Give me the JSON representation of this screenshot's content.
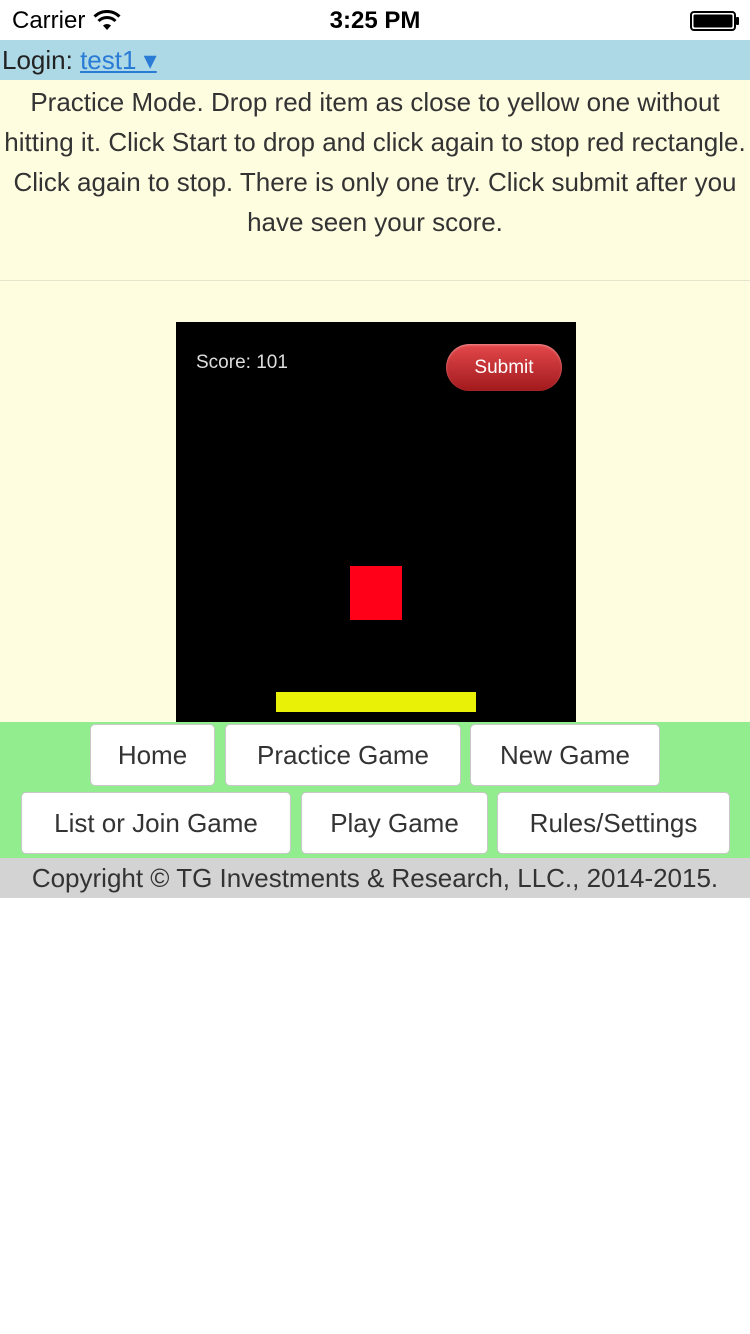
{
  "status_bar": {
    "carrier": "Carrier",
    "time": "3:25 PM"
  },
  "login": {
    "label": "Login:",
    "user": "test1 ▾"
  },
  "instructions": "Practice Mode. Drop red item as close to yellow one without hitting it. Click Start to drop and click again to stop red rectangle. Click again to stop. There is only one try. Click submit after you have seen your score.",
  "game": {
    "score": "Score: 101",
    "submit_label": "Submit"
  },
  "nav": {
    "home": "Home",
    "practice_game": "Practice Game",
    "new_game": "New Game",
    "list_or_join_game": "List or Join Game",
    "play_game": "Play Game",
    "rules_settings": "Rules/Settings"
  },
  "footer": "Copyright © TG Investments & Research, LLC., 2014-2015.",
  "colors": {
    "login_bar": "#add8e6",
    "instructions_bg": "#fffde0",
    "nav_bg": "#92ed8f",
    "footer_bg": "#d3d3d3",
    "red_item": "#ff0018",
    "yellow_item": "#e9f206"
  }
}
